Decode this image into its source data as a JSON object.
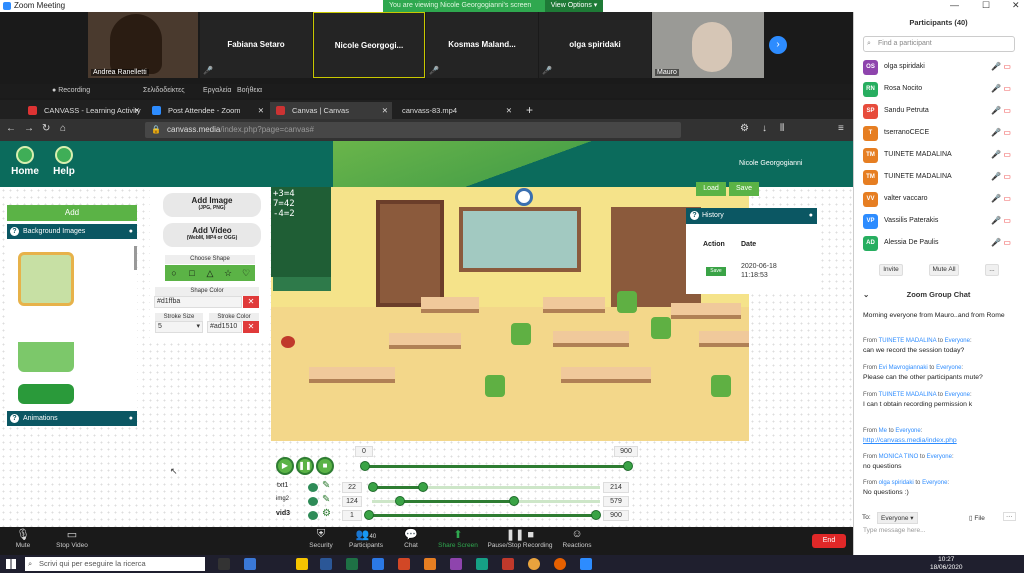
{
  "zoom": {
    "title": "Zoom Meeting",
    "banner": "You are viewing Nicole Georgogianni's screen",
    "view_options": "View Options",
    "tiles": [
      {
        "name": "Andrea Rapelletti",
        "caption": "Andrea Ranelletti"
      },
      {
        "name": "Fabiana Setaro"
      },
      {
        "name": "Nicole  Georgogi..."
      },
      {
        "name": "Kosmas  Maland..."
      },
      {
        "name": "olga spiridaki"
      },
      {
        "name": "Mauro",
        "caption": "Mauro"
      }
    ],
    "recording": "Recording",
    "toolbar": {
      "mute": "Mute",
      "stop_video": "Stop Video",
      "security": "Security",
      "participants": "Participants",
      "participants_count": "40",
      "chat": "Chat",
      "share": "Share Screen",
      "record": "Pause/Stop Recording",
      "reactions": "Reactions",
      "end": "End"
    }
  },
  "browser": {
    "menu": [
      "Σελιδοδείκτες",
      "Εργαλεία",
      "Βοήθεια"
    ],
    "tabs": [
      "CANVASS - Learning Activity C",
      "Post Attendee - Zoom",
      "Canvas | Canvas",
      "canvass-83.mp4"
    ],
    "url_host": "canvass.media",
    "url_path": "/index.php?page=canvas#"
  },
  "app": {
    "home": "Home",
    "help": "Help",
    "user": "Nicole Georgogianni",
    "add": "Add",
    "background_images": "Background Images",
    "animations": "Animations",
    "add_image": "Add Image",
    "add_image_sub": "(JPG, PNG)",
    "add_video": "Add Video",
    "add_video_sub": "(WebM, MP4 or OGG)",
    "choose_shape": "Choose Shape",
    "shape_color": "Shape Color",
    "shape_color_value": "#d1ffba",
    "stroke_size": "Stroke Size",
    "stroke_size_value": "5",
    "stroke_color": "Stroke Color",
    "stroke_color_value": "#ad1510",
    "chalk_lines": [
      "+3=4",
      "7=42",
      "-4=2"
    ],
    "load": "Load",
    "save": "Save",
    "history": {
      "title": "History",
      "col_action": "Action",
      "col_date": "Date",
      "row_action": "Save",
      "row_date": "2020-06-18",
      "row_time": "11:18:53"
    },
    "timeline": {
      "start": "0",
      "end": "900",
      "rows": [
        {
          "label": "txt1",
          "from": "22",
          "to": "214"
        },
        {
          "label": "img2",
          "from": "124",
          "to": "579"
        },
        {
          "label": "vid3",
          "from": "1",
          "to": "900"
        }
      ]
    }
  },
  "participants": {
    "title": "Participants (40)",
    "search_placeholder": "Find a participant",
    "list": [
      {
        "initials": "OS",
        "name": "olga spiridaki",
        "color": "#8e44ad"
      },
      {
        "initials": "RN",
        "name": "Rosa Nocito",
        "color": "#27ae60"
      },
      {
        "initials": "SP",
        "name": "Sandu Petruta",
        "color": "#e74c3c"
      },
      {
        "initials": "T",
        "name": "tserranoCECE",
        "color": "#e67e22"
      },
      {
        "initials": "TM",
        "name": "TUINETE MADALINA",
        "color": "#e67e22"
      },
      {
        "initials": "TM",
        "name": "TUINETE MADALINA",
        "color": "#e67e22"
      },
      {
        "initials": "VV",
        "name": "valter vaccaro",
        "color": "#e67e22"
      },
      {
        "initials": "VP",
        "name": "Vassilis Paterakis",
        "color": "#2d8cff"
      },
      {
        "initials": "AD",
        "name": "Alessia De Paulis",
        "color": "#27ae60"
      }
    ],
    "invite": "Invite",
    "mute_all": "Mute All",
    "more": "..."
  },
  "chat": {
    "title": "Zoom Group Chat",
    "messages": [
      {
        "from": "",
        "to": "",
        "text": "Morning everyone from Mauro..and from Rome"
      },
      {
        "from": "TUINETE MADALINA",
        "to": "Everyone",
        "text": "can we record the session today?"
      },
      {
        "from": "Evi Mavrogiannaki",
        "to": "Everyone",
        "text": "Please can the other participants mute?"
      },
      {
        "from": "TUINETE MADALINA",
        "to": "Everyone",
        "text": "I can t obtain recording permission k"
      },
      {
        "from": "Me",
        "to": "Everyone",
        "text": "http://canvass.media/index.php"
      },
      {
        "from": "MONICA TINO",
        "to": "Everyone",
        "text": "no questions"
      },
      {
        "from": "olga spiridaki",
        "to": "Everyone",
        "text": "No questions :)"
      }
    ],
    "from_word": "From",
    "to_word": "to",
    "to_label": "To:",
    "to_value": "Everyone",
    "file": "File",
    "placeholder": "Type message here..."
  },
  "taskbar": {
    "search": "Scrivi qui per eseguire la ricerca",
    "time": "10:27",
    "date": "18/06/2020"
  }
}
